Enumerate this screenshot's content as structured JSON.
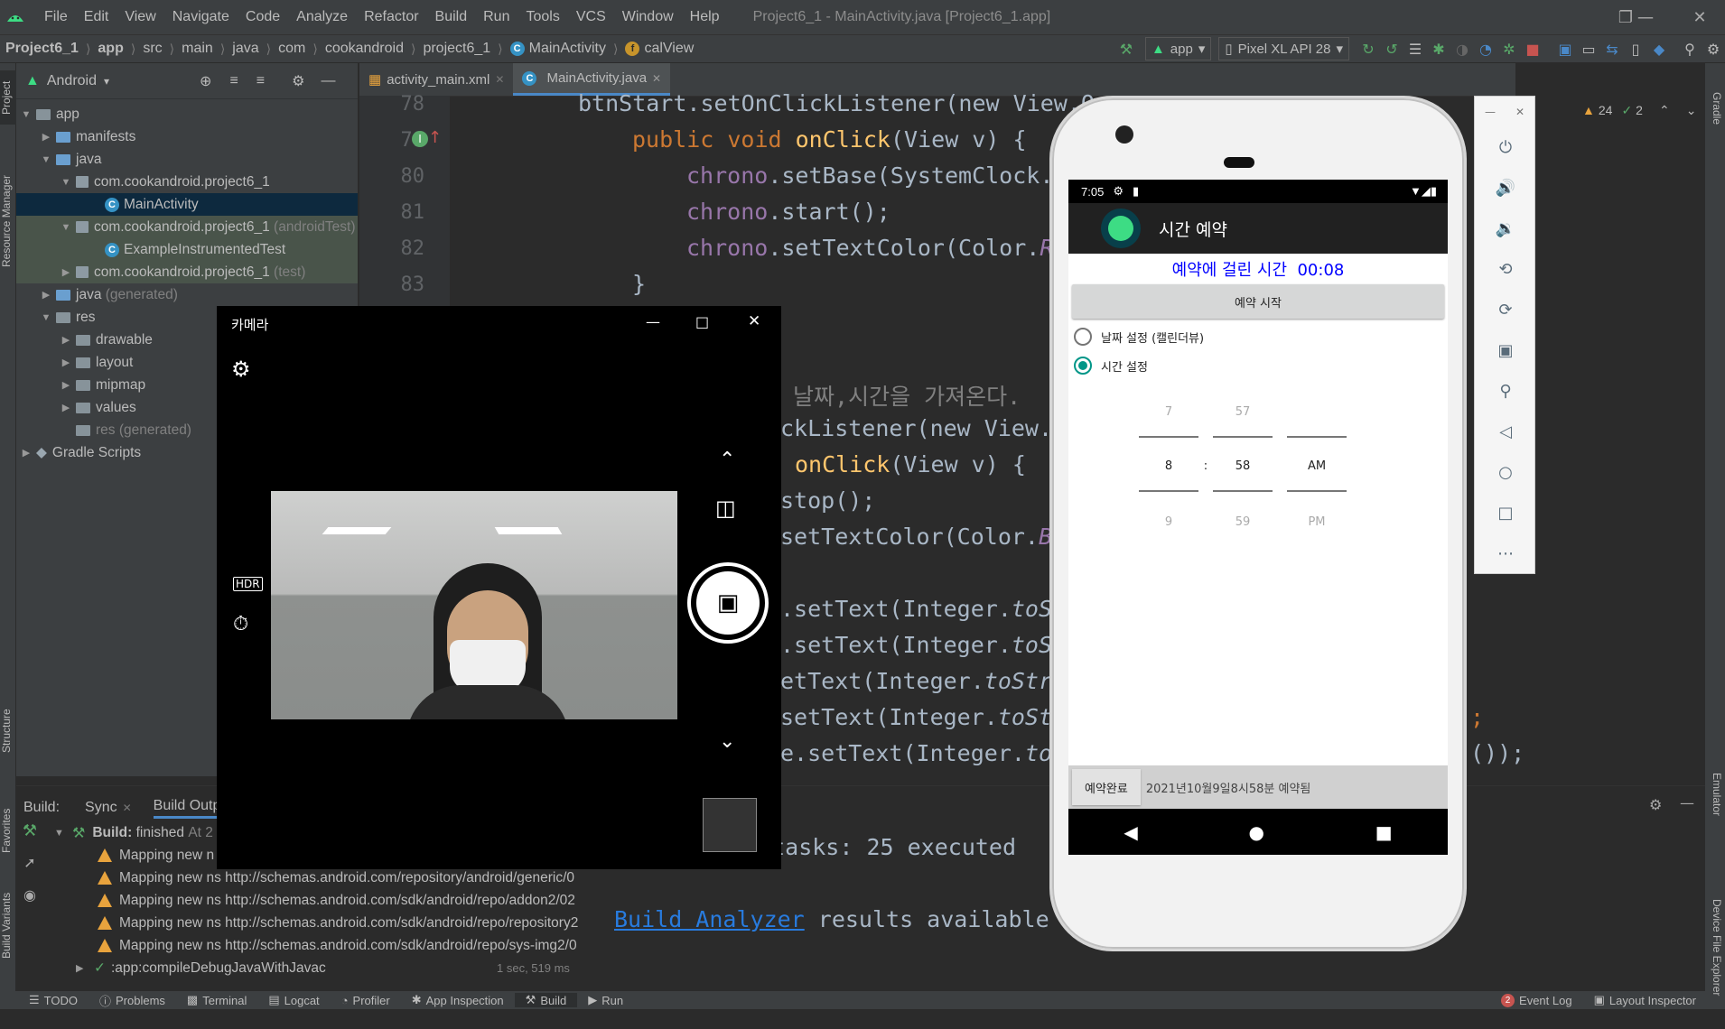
{
  "menu": {
    "items": [
      "File",
      "Edit",
      "View",
      "Navigate",
      "Code",
      "Analyze",
      "Refactor",
      "Build",
      "Run",
      "Tools",
      "VCS",
      "Window",
      "Help"
    ],
    "window_title": "Project6_1 - MainActivity.java [Project6_1.app]"
  },
  "breadcrumb": [
    "Project6_1",
    "app",
    "src",
    "main",
    "java",
    "com",
    "cookandroid",
    "project6_1",
    "MainActivity",
    "calView"
  ],
  "toolbar": {
    "config": "app",
    "device": "Pixel XL API 28"
  },
  "project_panel": {
    "view_mode": "Android",
    "tree": [
      {
        "label": "app",
        "indent": 0
      },
      {
        "label": "manifests",
        "indent": 1
      },
      {
        "label": "java",
        "indent": 1
      },
      {
        "label": "com.cookandroid.project6_1",
        "indent": 2
      },
      {
        "label": "MainActivity",
        "indent": 3
      },
      {
        "label": "com.cookandroid.project6_1",
        "suffix": "(androidTest)",
        "indent": 2
      },
      {
        "label": "ExampleInstrumentedTest",
        "indent": 3
      },
      {
        "label": "com.cookandroid.project6_1",
        "suffix": "(test)",
        "indent": 2
      },
      {
        "label": "java",
        "suffix": "(generated)",
        "indent": 1
      },
      {
        "label": "res",
        "indent": 1
      },
      {
        "label": "drawable",
        "indent": 2
      },
      {
        "label": "layout",
        "indent": 2
      },
      {
        "label": "mipmap",
        "indent": 2
      },
      {
        "label": "values",
        "indent": 2
      },
      {
        "label": "res (generated)",
        "indent": 2
      },
      {
        "label": "Gradle Scripts",
        "indent": 0
      }
    ]
  },
  "editor": {
    "tabs": [
      "activity_main.xml",
      "MainActivity.java"
    ],
    "line_numbers": [
      "78",
      "79",
      "80",
      "81",
      "82",
      "83"
    ],
    "lines": {
      "l78": "btnStart.setOnClickListener(new View.O",
      "l79_kw": "public void ",
      "l79_fn": "onClick",
      "l79_rest": "(View v) {",
      "l80_f": "chrono",
      "l80_rest": ".setBase(SystemClock.",
      "l81_f": "chrono",
      "l81_rest": ".start();",
      "l82_f": "chrono",
      "l82_rest": ".setTextColor(Color.",
      "l82_it": "R",
      "l83": "}",
      "c1": "된 날짜,시간을 가져온다.",
      "c2": "ckListener(new View.",
      "c3_fn": "onClick",
      "c3_rest": "(View v) {",
      "c4": "stop();",
      "c5": "setTextColor(Color.",
      "c5_it": "B",
      "c6": ".setText(Integer.",
      "c6_it": "toSt",
      "c7": ".setText(Integer.",
      "c7_it": "toS",
      "c8": "etText(Integer.",
      "c8_it": "toStr",
      "c9": "setText(Integer.",
      "c9_it": "toSt",
      "c10": "e.setText(Integer.",
      "c10_it": "to",
      "c10_end": "());",
      "c9_end": ";"
    },
    "inspection": {
      "warnings": "24",
      "weak": "2"
    }
  },
  "build": {
    "tabs": [
      "Build:",
      "Sync",
      "Build Outp"
    ],
    "status_label": "Build:",
    "status_text": "finished",
    "status_time": "At 2",
    "items": [
      "Mapping new n",
      "Mapping new ns http://schemas.android.com/repository/android/generic/0",
      "Mapping new ns http://schemas.android.com/sdk/android/repo/addon2/02",
      "Mapping new ns http://schemas.android.com/sdk/android/repo/repository2",
      "Mapping new ns http://schemas.android.com/sdk/android/repo/sys-img2/0"
    ],
    "task": ":app:compileDebugJavaWithJavac",
    "task_time": "1 sec, 519 ms",
    "output_l1": "e tasks: 25 executed",
    "output_link": "Build Analyzer",
    "output_l2": " results available"
  },
  "statusbar": [
    "TODO",
    "Problems",
    "Terminal",
    "Logcat",
    "Profiler",
    "App Inspection",
    "Build",
    "Run"
  ],
  "statusbar_right": {
    "event_log": "Event Log",
    "event_count": "2",
    "layout_inspector": "Layout Inspector"
  },
  "left_strip": [
    "Project",
    "Resource Manager",
    "Structure",
    "Favorites",
    "Build Variants"
  ],
  "right_strip": [
    "Gradle",
    "Emulator",
    "Device File Explorer"
  ],
  "camera": {
    "title": "카메라"
  },
  "phone": {
    "time": "7:05",
    "app_title": "시간 예약",
    "elapsed_label": "예약에 걸린 시간",
    "elapsed_value": "00:08",
    "start_button": "예약 시작",
    "radio_date": "날짜 설정 (캘린더뷰)",
    "radio_time": "시간 설정",
    "picker": {
      "hour_prev": "7",
      "hour": "8",
      "hour_next": "9",
      "min_prev": "57",
      "min": "58",
      "min_next": "59",
      "ampm": "AM",
      "ampm_next": "PM",
      "colon": ":"
    },
    "done_button": "예약완료",
    "result_text": "2021년10월9일8시58분 예약됨"
  },
  "colors": {
    "accent": "#4a88c7",
    "teal": "#009688",
    "warning": "#e8a33d",
    "blue_text": "#0000ff"
  }
}
